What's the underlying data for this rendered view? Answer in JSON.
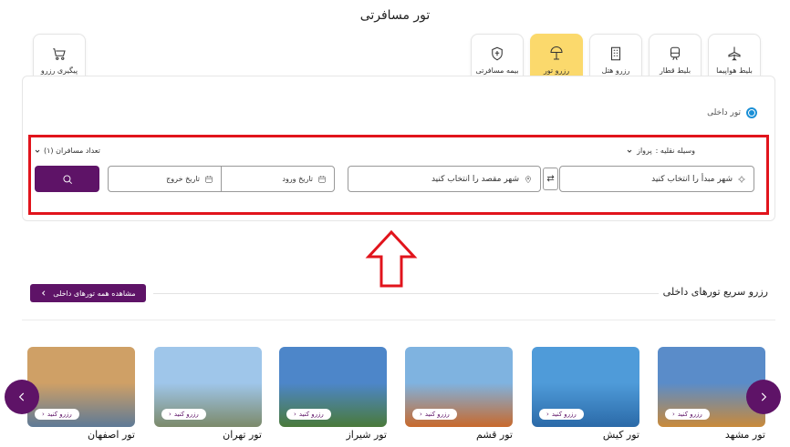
{
  "page": {
    "title": "تور مسافرتی"
  },
  "tabs": [
    {
      "label": "بلیط هواپیما",
      "icon": "airplane-icon",
      "active": false
    },
    {
      "label": "بلیط قطار",
      "icon": "train-icon",
      "active": false
    },
    {
      "label": "رزرو هتل",
      "icon": "hotel-icon",
      "active": false
    },
    {
      "label": "رزرو تور",
      "icon": "beach-umbrella-icon",
      "active": true
    },
    {
      "label": "بیمه مسافرتی",
      "icon": "shield-plane-icon",
      "active": false
    }
  ],
  "tracking": {
    "label": "پیگیری رزرو",
    "icon": "cart-icon"
  },
  "search": {
    "tour_type": "تور داخلی",
    "vehicle_label": "وسیله نقلیه :",
    "vehicle_value": "پرواز",
    "passengers": "تعداد مسافران (۱)",
    "origin_placeholder": "شهر مبدأ را انتخاب کنید",
    "destination_placeholder": "شهر مقصد را انتخاب کنید",
    "checkin_label": "تاریخ ورود",
    "checkout_label": "تاریخ خروج"
  },
  "section": {
    "title": "رزرو سریع تورهای داخلی",
    "view_all": "مشاهده همه تورهای داخلی"
  },
  "tours": [
    {
      "name": "تور مشهد",
      "badge": "رزرو کنید",
      "sky": "#5a8cc9",
      "ground": "#c98a3a"
    },
    {
      "name": "تور کیش",
      "badge": "رزرو کنید",
      "sky": "#4f9bd9",
      "ground": "#2b6aa8"
    },
    {
      "name": "تور قشم",
      "badge": "رزرو کنید",
      "sky": "#7fb3e0",
      "ground": "#c8692c"
    },
    {
      "name": "تور شیراز",
      "badge": "رزرو کنید",
      "sky": "#4d86c9",
      "ground": "#4a7a3a"
    },
    {
      "name": "تور تهران",
      "badge": "رزرو کنید",
      "sky": "#9fc6ea",
      "ground": "#7c8a6a"
    },
    {
      "name": "تور اصفهان",
      "badge": "رزرو کنید",
      "sky": "#cfa066",
      "ground": "#5e7a96"
    }
  ],
  "colors": {
    "brand": "#5e1367",
    "active_tab": "#fbd96c",
    "highlight_box": "#e1141c",
    "radio": "#1a8fd6"
  }
}
